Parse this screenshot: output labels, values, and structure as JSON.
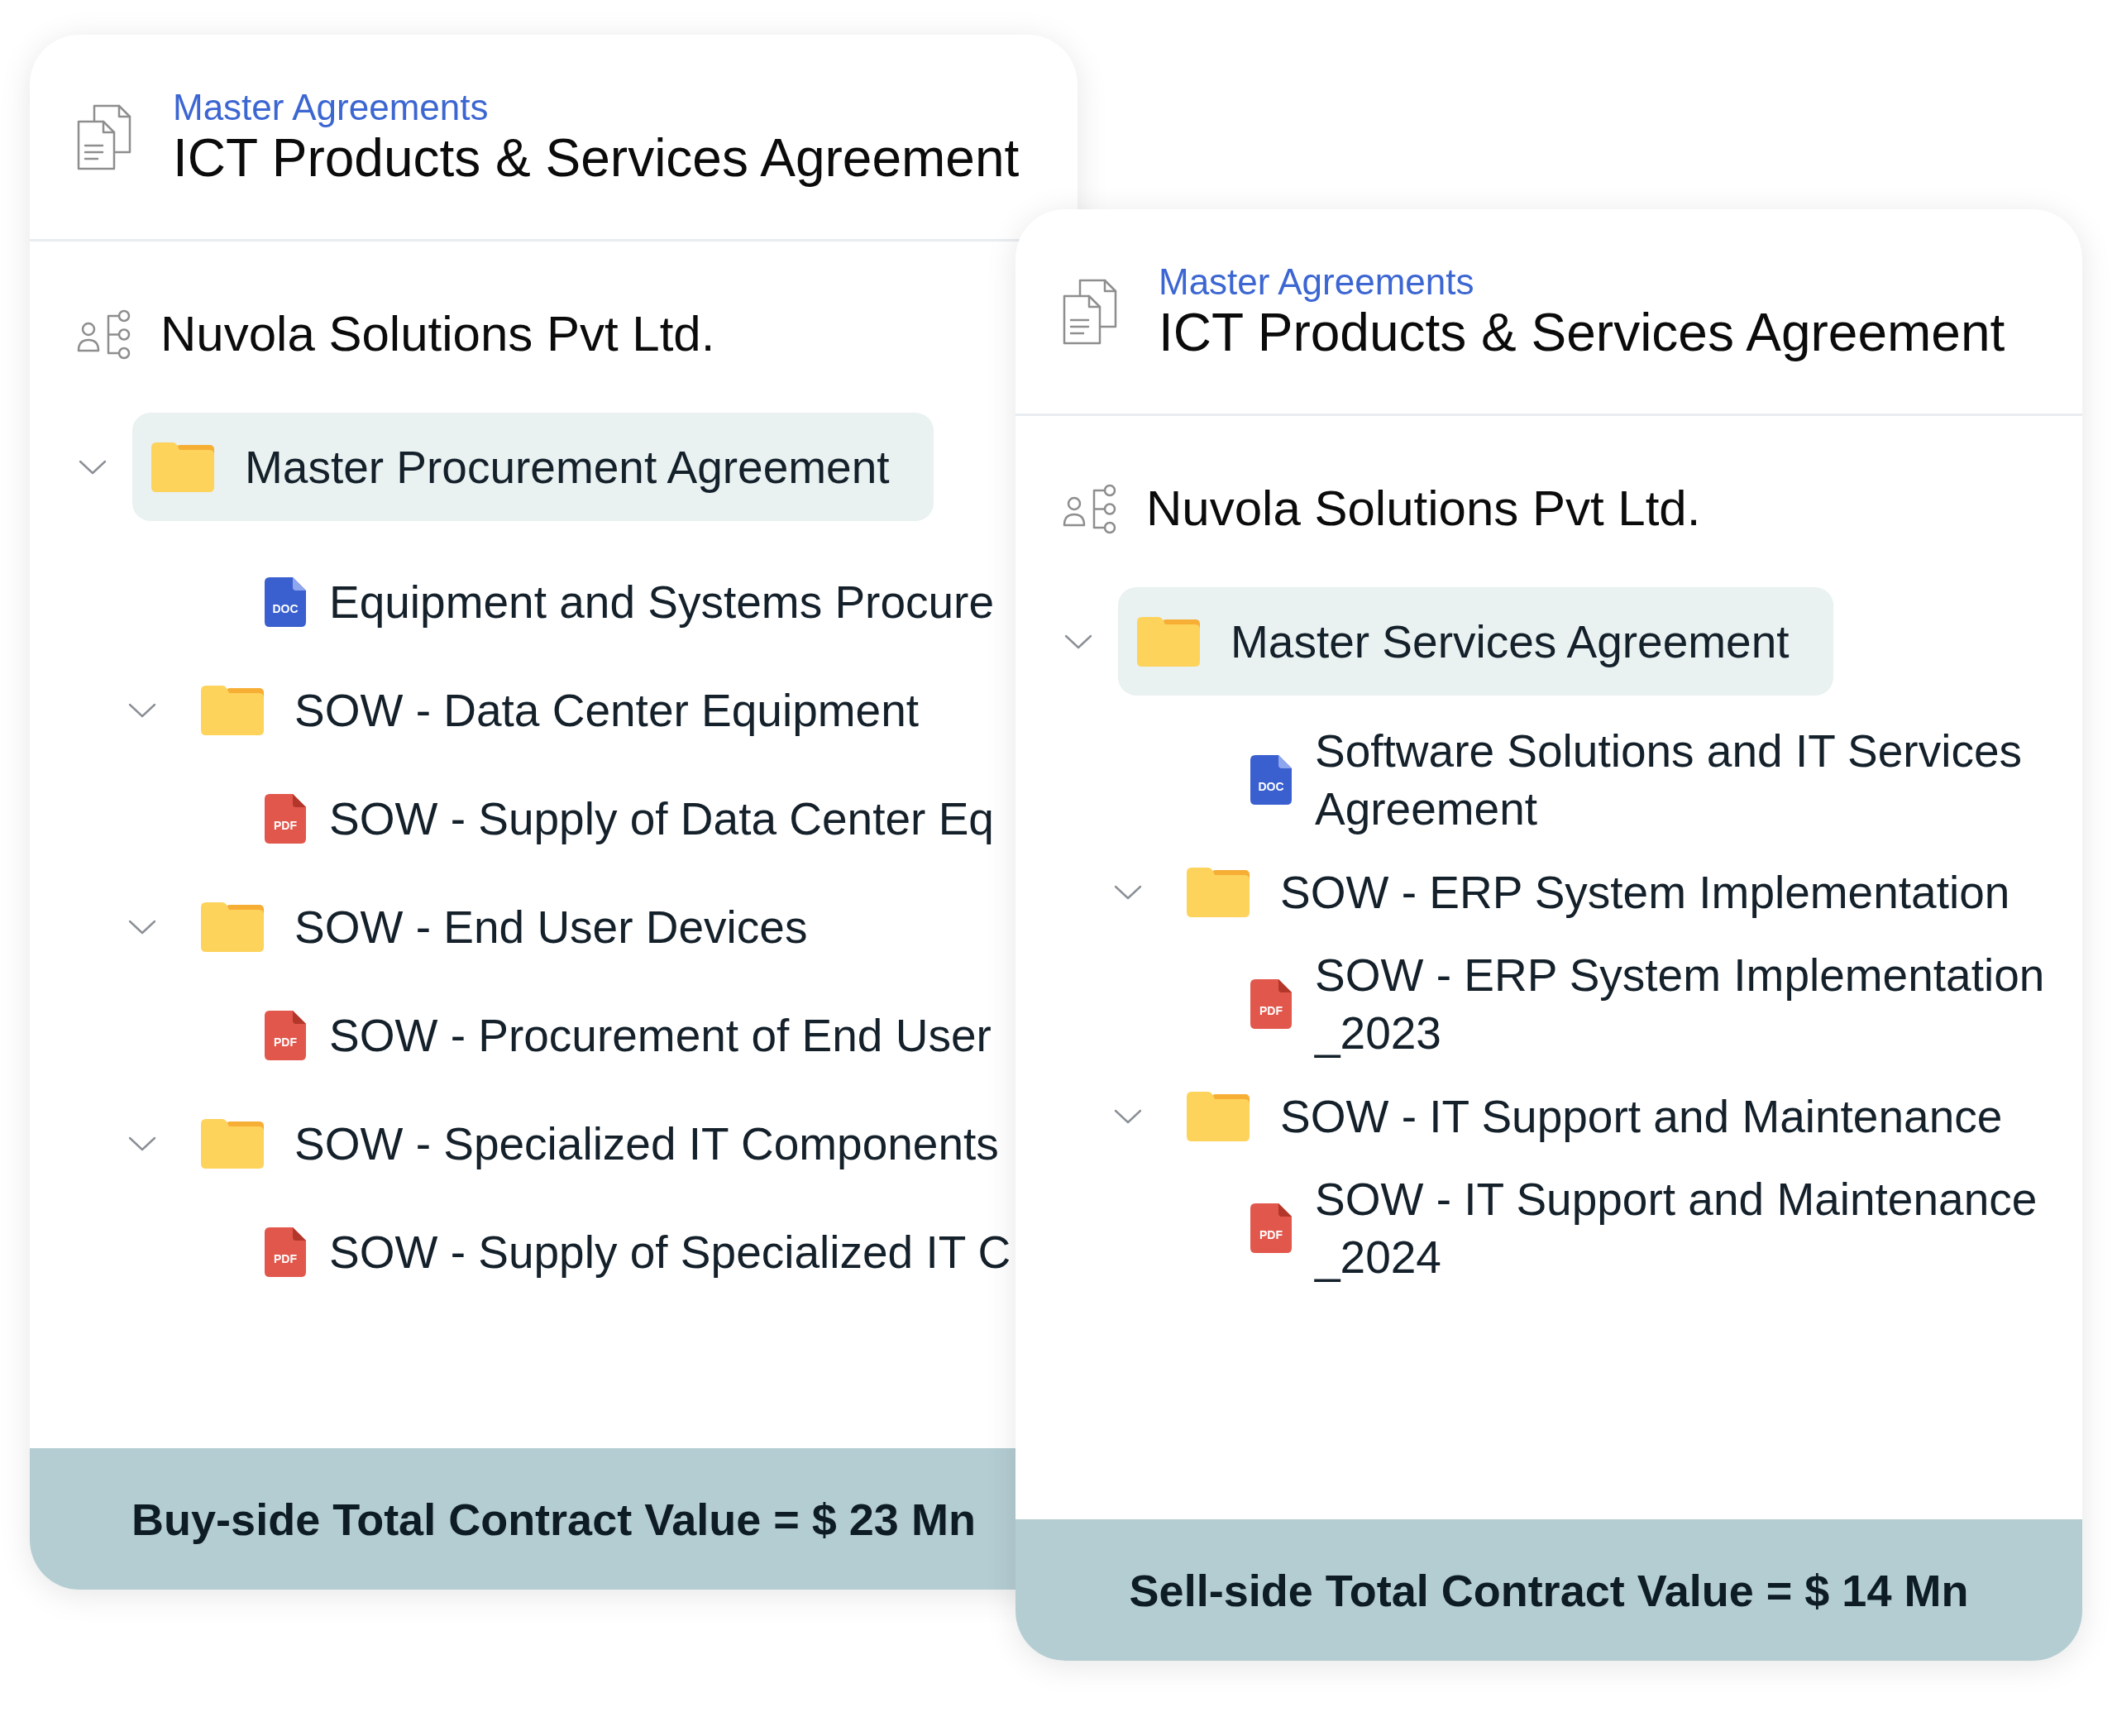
{
  "cards": [
    {
      "header": {
        "category": "Master Agreements",
        "title": "ICT Products & Services Agreement"
      },
      "company": "Nuvola Solutions Pvt Ltd.",
      "tree": [
        {
          "kind": "folder",
          "label": "Master Procurement Agreement",
          "selected": true,
          "expanded": true,
          "children": [
            {
              "kind": "doc",
              "badge": "DOC",
              "label": "Equipment and Systems Procure",
              "selected": false
            },
            {
              "kind": "folder",
              "label": "SOW - Data Center Equipment",
              "selected": false,
              "expanded": true,
              "children": [
                {
                  "kind": "pdf",
                  "badge": "PDF",
                  "label": "SOW - Supply of Data Center Eq",
                  "selected": false
                }
              ]
            },
            {
              "kind": "folder",
              "label": "SOW - End User Devices",
              "selected": false,
              "expanded": true,
              "children": [
                {
                  "kind": "pdf",
                  "badge": "PDF",
                  "label": "SOW - Procurement of End User",
                  "selected": false
                }
              ]
            },
            {
              "kind": "folder",
              "label": "SOW - Specialized IT Components",
              "selected": false,
              "expanded": true,
              "children": [
                {
                  "kind": "pdf",
                  "badge": "PDF",
                  "label": "SOW - Supply of Specialized IT C",
                  "selected": false
                }
              ]
            }
          ]
        }
      ],
      "footer": "Buy-side Total Contract Value = $ 23 Mn"
    },
    {
      "header": {
        "category": "Master Agreements",
        "title": "ICT Products & Services Agreement"
      },
      "company": "Nuvola Solutions Pvt Ltd.",
      "tree": [
        {
          "kind": "folder",
          "label": "Master Services Agreement",
          "selected": true,
          "expanded": true,
          "children": [
            {
              "kind": "doc",
              "badge": "DOC",
              "label": "Software Solutions and IT Services Agreement",
              "selected": false
            },
            {
              "kind": "folder",
              "label": "SOW - ERP System Implementation",
              "selected": false,
              "expanded": true,
              "children": [
                {
                  "kind": "pdf",
                  "badge": "PDF",
                  "label": "SOW - ERP System Implementation _2023",
                  "selected": false
                }
              ]
            },
            {
              "kind": "folder",
              "label": "SOW - IT Support and Maintenance",
              "selected": false,
              "expanded": true,
              "children": [
                {
                  "kind": "pdf",
                  "badge": "PDF",
                  "label": "SOW - IT Support and Maintenance _2024",
                  "selected": false
                }
              ]
            }
          ]
        }
      ],
      "footer": "Sell-side Total Contract Value = $ 14 Mn"
    }
  ]
}
